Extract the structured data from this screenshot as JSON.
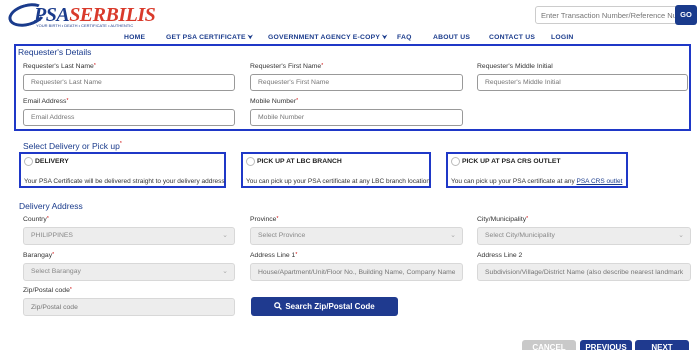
{
  "header": {
    "logo": {
      "text_main": "PSA",
      "text_accent": "SERBILIS",
      "tagline": "YOUR BIRTH • DEATH • CERTIFICATE • AUTHENTIC"
    },
    "track_input_placeholder": "Enter Transaction Number/Reference Numb",
    "go_label": "GO"
  },
  "nav": {
    "items": [
      {
        "label": "HOME"
      },
      {
        "label": "GET PSA CERTIFICATE",
        "chevron": "⮟"
      },
      {
        "label": "GOVERNMENT AGENCY E-COPY",
        "chevron": "⮟"
      },
      {
        "label": "FAQ"
      },
      {
        "label": "ABOUT US"
      },
      {
        "label": "CONTACT US"
      },
      {
        "label": "LOGIN"
      }
    ]
  },
  "requester": {
    "title": "Requester's Details",
    "last_name": {
      "label": "Requester's Last Name",
      "placeholder": "Requester's Last Name"
    },
    "first_name": {
      "label": "Requester's First Name",
      "placeholder": "Requester's First Name"
    },
    "middle_initial": {
      "label": "Requester's Middle Initial",
      "placeholder": "Requester's Middle Initial"
    },
    "email": {
      "label": "Email Address",
      "placeholder": "Email Address"
    },
    "mobile": {
      "label": "Mobile Number",
      "placeholder": "Mobile Number"
    },
    "required_mark": "*"
  },
  "delivery_option": {
    "title": "Select Delivery or Pick up",
    "options": [
      {
        "title": "DELIVERY",
        "desc": "Your PSA Certificate will be delivered straight to your delivery address"
      },
      {
        "title": "PICK UP AT LBC BRANCH",
        "desc": "You can pick up your PSA certificate at any LBC branch location"
      },
      {
        "title": "PICK UP AT PSA CRS OUTLET",
        "desc": "You can pick up your PSA certificate at any ",
        "link": "PSA CRS outlet"
      }
    ]
  },
  "address": {
    "title": "Delivery Address",
    "country": {
      "label": "Country",
      "value": "PHILIPPINES"
    },
    "province": {
      "label": "Province",
      "value": "Select Province"
    },
    "city": {
      "label": "City/Municipality",
      "value": "Select City/Municipality"
    },
    "barangay": {
      "label": "Barangay",
      "value": "Select Barangay"
    },
    "address1": {
      "label": "Address Line 1",
      "placeholder": "House/Apartment/Unit/Floor No., Building Name, Company Name (if of"
    },
    "address2": {
      "label": "Address Line 2",
      "placeholder": "Subdivision/Village/District Name (also describe nearest landmark if po"
    },
    "zip": {
      "label": "Zip/Postal code",
      "placeholder": "Zip/Postal code"
    },
    "search_zip_label": "Search Zip/Postal Code",
    "select_caret": "⌄"
  },
  "actions": {
    "cancel": "CANCEL",
    "previous": "PREVIOUS",
    "next": "NEXT"
  },
  "colors": {
    "brand": "#1a3b8c",
    "highlight_border": "#1f38c7",
    "accent_red": "#d93a2b"
  }
}
